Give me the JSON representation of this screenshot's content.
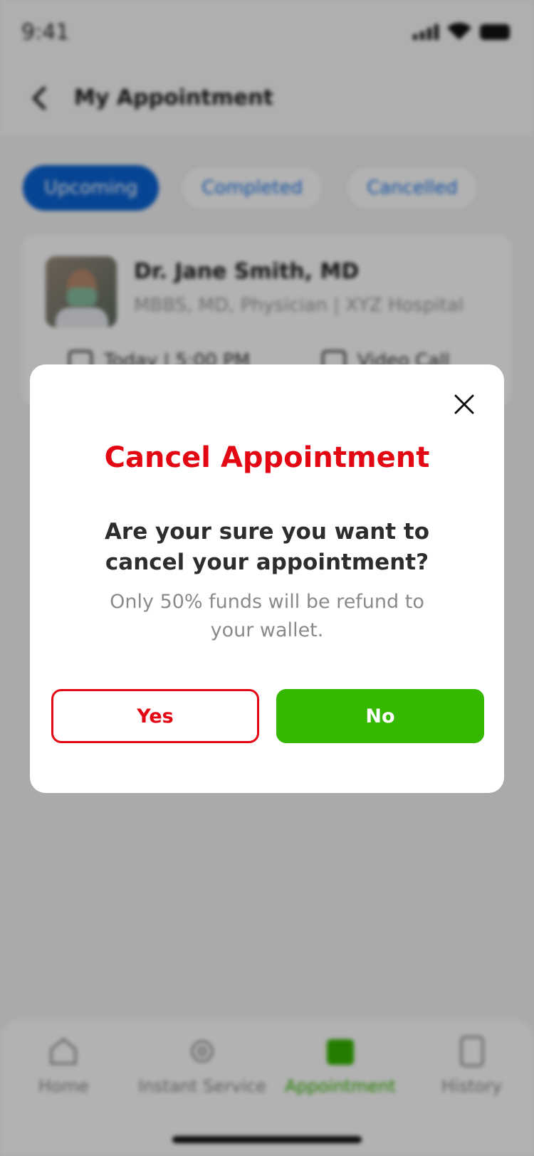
{
  "status": {
    "time": "9:41"
  },
  "header": {
    "title": "My Appointment"
  },
  "tabs": [
    {
      "label": "Upcoming",
      "active": true
    },
    {
      "label": "Completed",
      "active": false
    },
    {
      "label": "Cancelled",
      "active": false
    }
  ],
  "appointment": {
    "doctor_name": "Dr. Jane Smith, MD",
    "doctor_details": "MBBS, MD, Physician | XYZ Hospital",
    "time": "Today | 5:00 PM",
    "mode": "Video Call"
  },
  "bottom_nav": [
    {
      "label": "Home",
      "icon": "home-icon"
    },
    {
      "label": "Instant Service",
      "icon": "gear-icon"
    },
    {
      "label": "Appointment",
      "icon": "calendar-icon",
      "active": true
    },
    {
      "label": "History",
      "icon": "history-icon"
    }
  ],
  "modal": {
    "title": "Cancel Appointment",
    "question": "Are your sure you want to cancel your appointment?",
    "note": "Only 50% funds will be refund to your wallet.",
    "yes_label": "Yes",
    "no_label": "No"
  },
  "colors": {
    "danger": "#e30613",
    "success": "#35b900",
    "primary": "#0a63d4"
  }
}
